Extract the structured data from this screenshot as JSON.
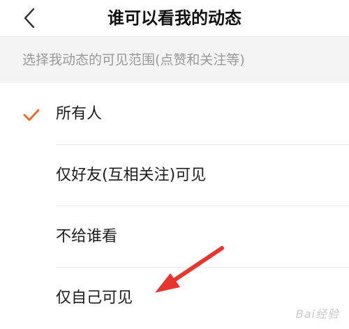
{
  "header": {
    "title": "谁可以看我的动态",
    "back_icon": "chevron-left-icon"
  },
  "section": {
    "label": "选择我动态的可见范围(点赞和关注等)"
  },
  "options": [
    {
      "label": "所有人",
      "selected": true
    },
    {
      "label": "仅好友(互相关注)可见",
      "selected": false
    },
    {
      "label": "不给谁看",
      "selected": false
    },
    {
      "label": "仅自己可见",
      "selected": false
    }
  ],
  "colors": {
    "accent": "#f26a2a",
    "annotation_arrow": "#e8352e"
  },
  "watermark": "Bai经验"
}
